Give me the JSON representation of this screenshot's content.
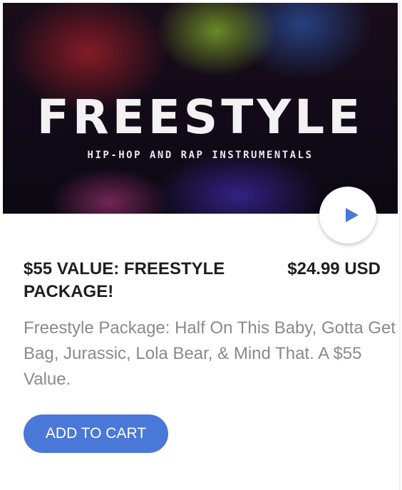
{
  "product": {
    "cover": {
      "title": "FREESTYLE",
      "subtitle": "HIP-HOP AND RAP INSTRUMENTALS"
    },
    "play_icon": "play-icon",
    "title": "$55 VALUE: FREESTYLE PACKAGE!",
    "price": "$24.99 USD",
    "description": "Freestyle Package: Half On This Baby, Gotta Get Bag, Jurassic, Lola Bear, & Mind That. A $55 Value.",
    "add_to_cart_label": "ADD TO CART"
  },
  "colors": {
    "accent": "#4a78d8",
    "title_text": "#1f1f1f",
    "description_text": "#8a8a8a"
  }
}
